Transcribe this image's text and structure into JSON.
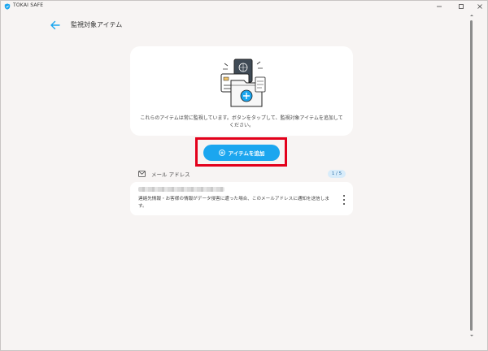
{
  "app": {
    "title": "TOKAI SAFE"
  },
  "header": {
    "title": "監視対象アイテム"
  },
  "info": {
    "text": "これらのアイテムは常に監視しています。ボタンをタップして、監視対象アイテムを追加してください。"
  },
  "actions": {
    "add_label": "アイテムを追加"
  },
  "section": {
    "label": "メール アドレス",
    "count": "1 / 5"
  },
  "email_item": {
    "description": "連絡先情報・お客様の情報がデータ侵害に遭った場合、このメールアドレスに通知を送信します。"
  },
  "colors": {
    "accent": "#1ba6ef",
    "highlight": "#e3001b",
    "badge_bg": "#d8ecfa"
  },
  "icons": [
    "shield-icon",
    "back-arrow-icon",
    "mail-icon",
    "plus-circle-icon",
    "more-vert-icon"
  ]
}
